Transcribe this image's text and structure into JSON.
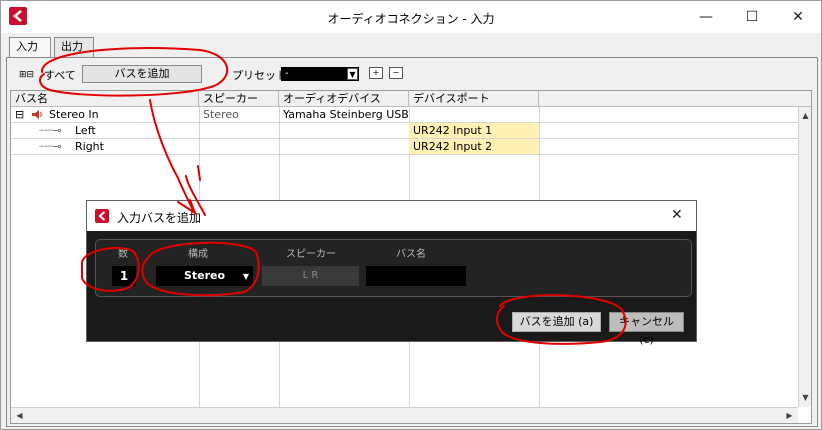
{
  "window": {
    "title": "オーディオコネクション - 入力",
    "minimize": "—",
    "maximize": "☐",
    "close": "✕"
  },
  "tabs": [
    {
      "label": "入力",
      "active": true
    },
    {
      "label": "出力",
      "active": false
    }
  ],
  "toolbar": {
    "all_label": "すべて",
    "add_bus_label": "バスを追加",
    "preset_label": "プリセット",
    "preset_value": "-"
  },
  "table": {
    "columns": [
      "バス名",
      "スピーカー",
      "オーディオデバイス",
      "デバイスポート"
    ],
    "rows": [
      {
        "name": "Stereo In",
        "speaker": "Stereo",
        "device": "Yamaha Steinberg USB AS",
        "port": ""
      },
      {
        "name": "Left",
        "speaker": "",
        "device": "",
        "port": "UR242 Input 1"
      },
      {
        "name": "Right",
        "speaker": "",
        "device": "",
        "port": "UR242 Input 2"
      }
    ]
  },
  "dialog": {
    "title": "入力バスを追加",
    "headers": {
      "count": "数",
      "config": "構成",
      "speaker": "スピーカー",
      "bus_name": "バス名"
    },
    "count_value": "1",
    "config_value": "Stereo",
    "speaker_value": "L R",
    "bus_name_value": "",
    "add_button": "バスを追加 (a)",
    "cancel_button": "キャンセル (c)"
  },
  "colors": {
    "annotation": "#e00000",
    "port_highlight": "#fff1b3",
    "dialog_bg": "#1a1a1a"
  }
}
